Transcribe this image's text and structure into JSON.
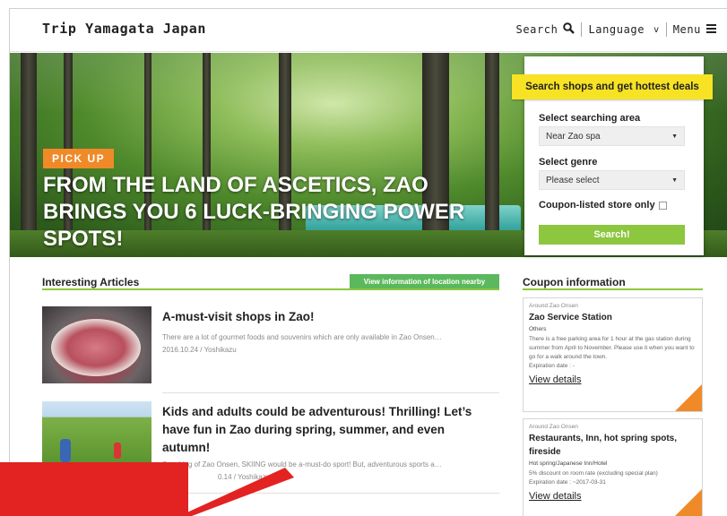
{
  "header": {
    "site_title": "Trip Yamagata Japan",
    "nav": {
      "search_label": "Search",
      "language_label": "Language",
      "language_chevron": "v",
      "menu_label": "Menu"
    }
  },
  "hero": {
    "badge": "PICK UP",
    "title": "FROM THE LAND OF ASCETICS, ZAO BRINGS YOU 6 LUCK-BRINGING POWER SPOTS!"
  },
  "search_panel": {
    "banner": "Search shops and get hottest deals",
    "area_label": "Select searching area",
    "area_value": "Near Zao spa",
    "genre_label": "Select genre",
    "genre_value": "Please select",
    "coupon_only_label": "Coupon-listed store only",
    "search_button": "Search!"
  },
  "articles": {
    "section_title": "Interesting Articles",
    "nearby_button": "View information of location nearby",
    "items": [
      {
        "title": "A-must-visit shops in Zao!",
        "excerpt": "There are a lot of gourmet foods and souvenirs which are only available in Zao Onsen…",
        "meta": "2016.10.24 / Yoshikazu"
      },
      {
        "title": "Kids and adults could be adventurous! Thrilling! Let’s have fun in Zao during spring, summer, and even autumn!",
        "excerpt": "Speaking of Zao Onsen, SKIING would be a-must-do sport! But, adventurous sports a…",
        "meta": "0.14 / Yoshikazu"
      }
    ]
  },
  "coupons": {
    "section_title": "Coupon information",
    "items": [
      {
        "area": "Around Zao Onsen",
        "name": "Zao Service Station",
        "genre": "Others",
        "description": "There is a free parking area for 1 hour at the gas station during summer from April to November. Please use it when you want to go for a walk around the town.",
        "expiration": "Expiration date : -",
        "link": "View details"
      },
      {
        "area": "Around Zao Onsen",
        "name": "Restaurants, Inn, hot spring spots, fireside",
        "genre": "Hot spring/Japanese Inn/Hotel",
        "description": "5% discount on room rate (excluding special plan)",
        "expiration": "Expiration date : ~2017-03-31",
        "link": "View details"
      }
    ]
  },
  "colors": {
    "accent_green": "#8dc63f",
    "pickup_orange": "#f08a28",
    "banner_yellow": "#f7e224",
    "overlay_red": "#e32222"
  }
}
